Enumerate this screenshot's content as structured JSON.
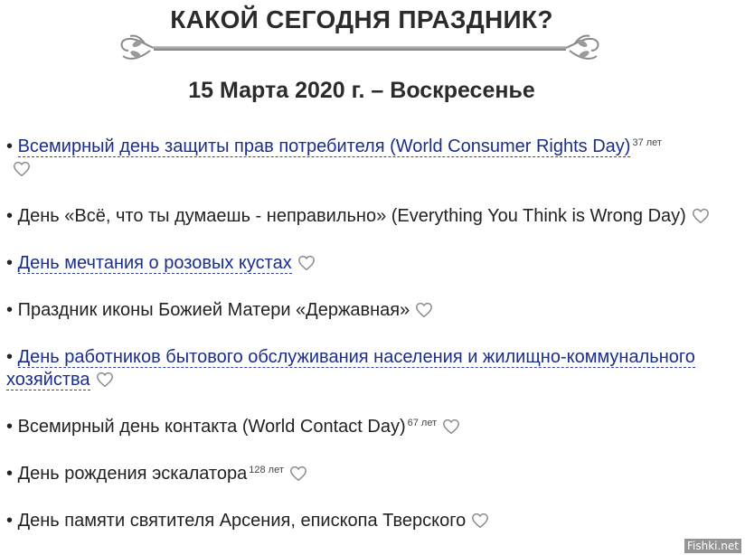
{
  "header": {
    "title": "КАКОЙ СЕГОДНЯ ПРАЗДНИК?",
    "date": "15 Марта 2020 г. – Воскресенье"
  },
  "icons": {
    "ornament": "floral-divider-icon",
    "favorite": "heart-outline-icon"
  },
  "colors": {
    "link": "#1a2e8c",
    "text": "#222222",
    "heart": "#8a8a8a"
  },
  "holidays": [
    {
      "bullet": "•",
      "text": "Всемирный день защиты прав потребителя (World Consumer Rights Day)",
      "is_link": true,
      "age": "37 лет"
    },
    {
      "bullet": "•",
      "text": "День «Всё, что ты думаешь - неправильно» (Everything You Think is Wrong Day)",
      "is_link": false,
      "age": ""
    },
    {
      "bullet": "•",
      "text": "День мечтания о розовых кустах",
      "is_link": true,
      "age": ""
    },
    {
      "bullet": "•",
      "text": "Праздник иконы Божией Матери «Державная»",
      "is_link": false,
      "age": ""
    },
    {
      "bullet": "•",
      "text": "День работников бытового обслуживания населения и жилищно-коммунального хозяйства",
      "is_link": true,
      "age": ""
    },
    {
      "bullet": "•",
      "text": "Всемирный день контакта (World Contact Day)",
      "is_link": false,
      "age": "67 лет"
    },
    {
      "bullet": "•",
      "text": "День рождения эскалатора",
      "is_link": false,
      "age": "128 лет"
    },
    {
      "bullet": "•",
      "text": "День памяти святителя Арсения, епископа Тверского",
      "is_link": false,
      "age": ""
    }
  ],
  "watermark": "Fishki.net"
}
